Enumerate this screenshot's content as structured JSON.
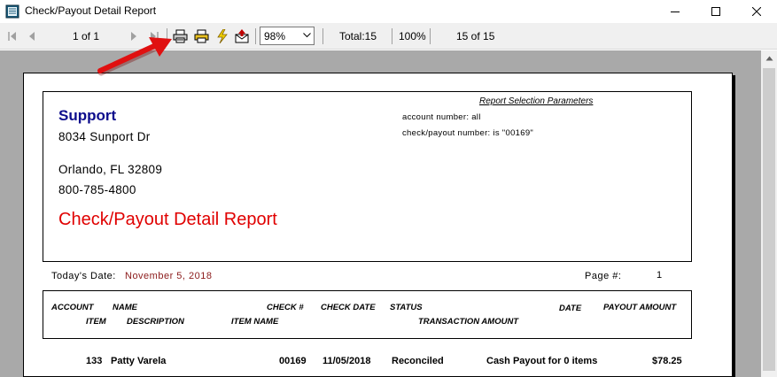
{
  "window": {
    "title": "Check/Payout Detail Report"
  },
  "toolbar": {
    "page_indicator": "1 of 1",
    "zoom_value": "98%",
    "total_label": "Total:15",
    "percent_label": "100%",
    "records_label": "15 of 15"
  },
  "report": {
    "company_name": "Support",
    "address_line1": "8034 Sunport Dr",
    "address_line2": "Orlando, FL 32809",
    "phone": "800-785-4800",
    "title": "Check/Payout Detail Report",
    "params_title": "Report Selection Parameters",
    "param_account": "account number: all",
    "param_check": "check/payout number: is \"00169\"",
    "date_label": "Today's Date:",
    "date_value": "November 5, 2018",
    "page_label": "Page #:",
    "page_value": "1",
    "columns_row1": {
      "account": "ACCOUNT",
      "name": "NAME",
      "check_no": "CHECK #",
      "check_date": "CHECK DATE",
      "status": "STATUS",
      "date": "DATE",
      "payout_amount": "PAYOUT AMOUNT"
    },
    "columns_row2": {
      "item": "ITEM",
      "description": "DESCRIPTION",
      "item_name": "ITEM NAME",
      "transaction_amount": "TRANSACTION AMOUNT"
    },
    "rows": [
      {
        "account": "133",
        "name": "Patty Varela",
        "check_no": "00169",
        "check_date": "11/05/2018",
        "status": "Reconciled",
        "description": "Cash Payout for 0 items",
        "amount": "$78.25"
      }
    ]
  },
  "colors": {
    "company": "#0d0d8c",
    "title_red": "#e00000",
    "date_red": "#8b1a1a",
    "annotation_arrow": "#e01010"
  }
}
